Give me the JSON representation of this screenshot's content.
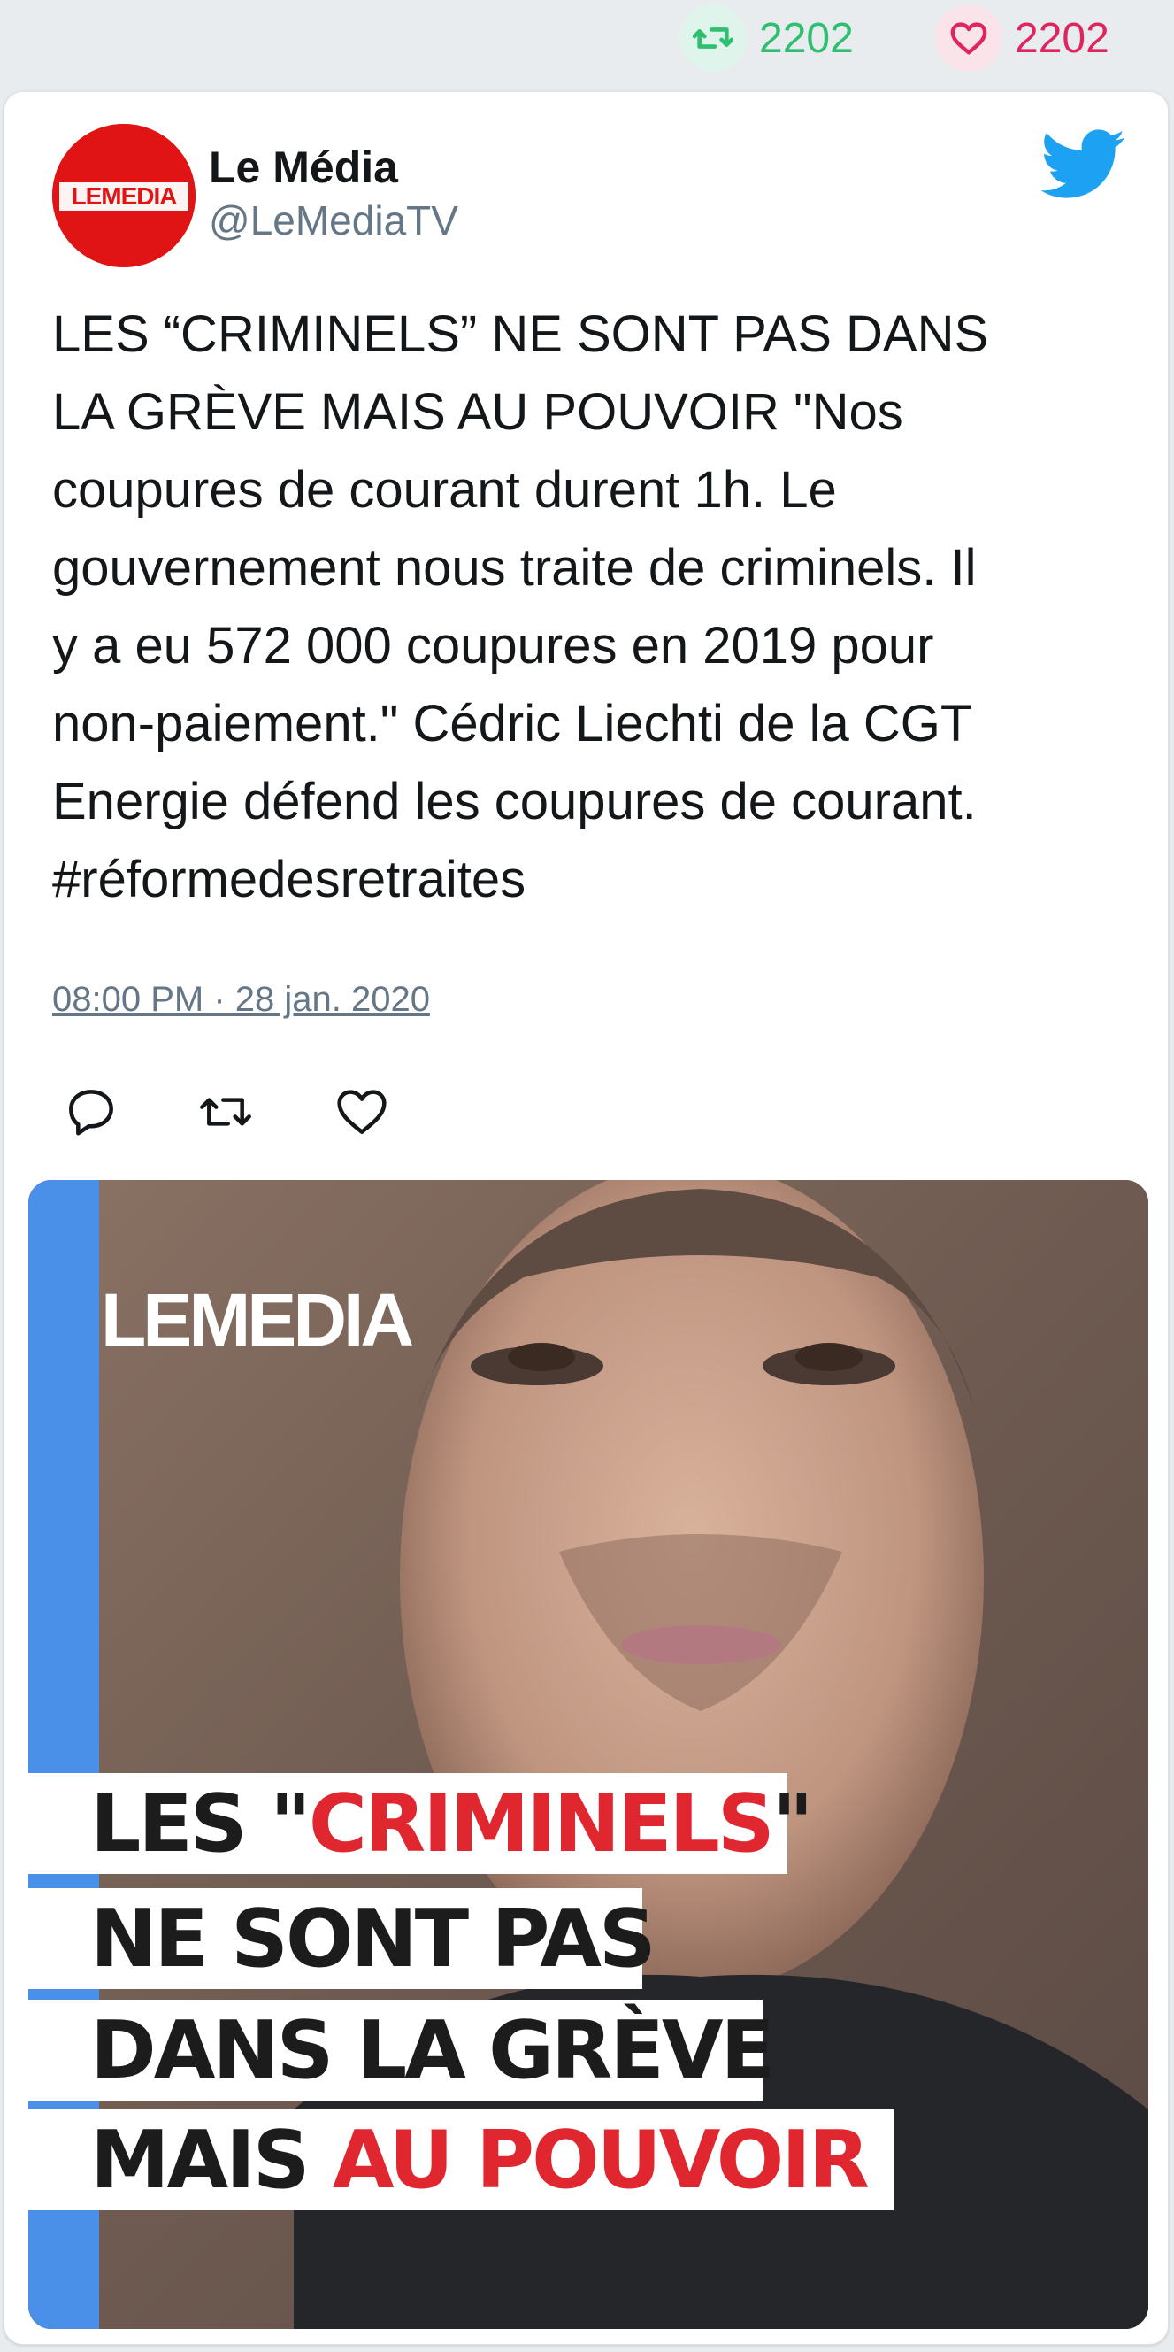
{
  "stats": {
    "retweets": "2202",
    "likes": "2202"
  },
  "colors": {
    "retweet": "#2fbf71",
    "like": "#e0245e",
    "twitter_blue": "#1da1f2",
    "text": "#14171a",
    "muted": "#657786",
    "headline_red": "#e02730"
  },
  "author": {
    "name": "Le Média",
    "handle": "@LeMediaTV",
    "avatar_text": "LE MEDIA"
  },
  "tweet": {
    "text": "LES “CRIMINELS” NE SONT PAS DANS\nLA GRÈVE MAIS AU POUVOIR \"Nos\ncoupures de courant durent 1h. Le\ngouvernement nous traite de criminels. Il\ny a eu 572 000 coupures en 2019 pour\nnon-paiement.\" Cédric Liechti de la CGT\nEnergie défend les coupures de courant.\n#réformedesretraites",
    "timestamp": "08:00 PM · 28 jan. 2020"
  },
  "icons": {
    "reply": "reply-icon",
    "retweet": "retweet-icon",
    "like": "heart-icon",
    "brand": "twitter-bird-icon"
  },
  "media": {
    "logo": "LEMEDIA",
    "headline": {
      "line1_a": "LES \"",
      "line1_b": "CRIMINELS",
      "line1_c": "\"",
      "line2": "NE SONT PAS",
      "line3": "DANS LA GRÈVE",
      "line4_a": "MAIS ",
      "line4_b": "AU POUVOIR"
    }
  }
}
